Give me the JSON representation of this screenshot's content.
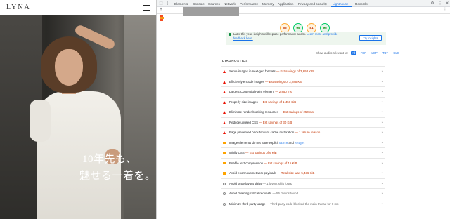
{
  "site": {
    "logo": "LYNA",
    "catch_line1": "10年先も、",
    "catch_line2": "魅せる一着を。"
  },
  "devtools": {
    "tabs": [
      "Elements",
      "Console",
      "Sources",
      "Network",
      "Performance",
      "Memory",
      "Application",
      "Privacy and security",
      "Lighthouse",
      "Recorder"
    ],
    "active_tab": "Lighthouse",
    "more_tabs": "»",
    "gauges": [
      {
        "score": "66",
        "color": "orange"
      },
      {
        "score": "95",
        "color": "green"
      },
      {
        "score": "81",
        "color": "orange"
      },
      {
        "score": "95",
        "color": "green"
      }
    ],
    "banner": {
      "text": "Later this year, insights will replace performance audits. ",
      "link1": "Learn more and provide",
      "link2": "feedback here.",
      "button": "Try insights"
    },
    "filter": {
      "label": "Show audits relevant to:",
      "chips": [
        "All",
        "FCP",
        "LCP",
        "TBT",
        "CLS"
      ],
      "active": "All"
    },
    "section_title": "DIAGNOSTICS",
    "audits": [
      {
        "status": "fail",
        "title": "Serve images in next-gen formats",
        "detail": "Est savings of 3,693 KiB",
        "sav": true
      },
      {
        "status": "fail",
        "title": "Efficiently encode images",
        "detail": "Est savings of 3,286 KiB",
        "sav": true
      },
      {
        "status": "fail",
        "title": "Largest Contentful Paint element",
        "detail": "2,850 ms",
        "sav": true
      },
      {
        "status": "fail",
        "title": "Properly size images",
        "detail": "Est savings of 1,456 KiB",
        "sav": true
      },
      {
        "status": "fail",
        "title": "Eliminate render-blocking resources",
        "detail": "Est savings of 250 ms",
        "sav": true
      },
      {
        "status": "fail",
        "title": "Reduce unused CSS",
        "detail": "Est savings of 30 KiB",
        "sav": true
      },
      {
        "status": "fail",
        "title": "Page prevented back/forward cache restoration",
        "detail": "1 failure reason",
        "sav": true
      },
      {
        "status": "avg",
        "title": "Image elements do not have explicit",
        "code1": "width",
        "mid": "and",
        "code2": "height"
      },
      {
        "status": "avg",
        "title": "Minify CSS",
        "detail": "Est savings of 6 KiB",
        "sav": true
      },
      {
        "status": "avg",
        "title": "Enable text compression",
        "detail": "Est savings of 15 KiB",
        "sav": true
      },
      {
        "status": "avg",
        "title": "Avoid enormous network payloads",
        "detail": "Total size was 5,436 KiB",
        "sav": true
      },
      {
        "status": "info",
        "title": "Avoid large layout shifts",
        "detail": "1 layout shift found",
        "sav": false
      },
      {
        "status": "info",
        "title": "Avoid chaining critical requests",
        "detail": "56 chains found",
        "sav": false
      },
      {
        "status": "info",
        "title": "Minimize third-party usage",
        "detail": "Third-party code blocked the main thread for 0 ms",
        "sav": false
      }
    ]
  }
}
